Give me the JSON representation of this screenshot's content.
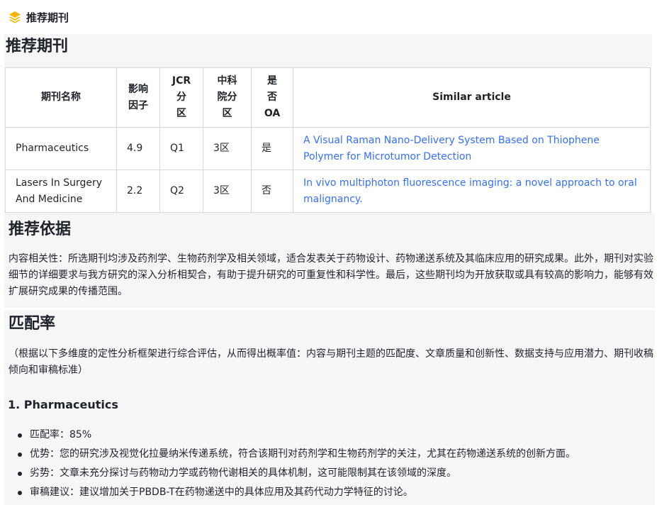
{
  "header": {
    "title": "推荐期刊",
    "icon": "layers-icon"
  },
  "recommend": {
    "title": "推荐期刊",
    "columns": [
      "期刊名称",
      "影响\n因子",
      "JCR\n分\n区",
      "中科\n院分\n区",
      "是\n否\nOA",
      "Similar article"
    ],
    "rows": [
      {
        "name": "Pharmaceutics",
        "if": "4.9",
        "jcr": "Q1",
        "cas": "3区",
        "oa": "是",
        "article": "A Visual Raman Nano-Delivery System Based on Thiophene Polymer for Microtumor Detection"
      },
      {
        "name": "Lasers In Surgery And Medicine",
        "if": "2.2",
        "jcr": "Q2",
        "cas": "3区",
        "oa": "否",
        "article": "In vivo multiphoton fluorescence imaging: a novel approach to oral malignancy."
      }
    ]
  },
  "basis": {
    "title": "推荐依据",
    "text": "内容相关性：所选期刊均涉及药剂学、生物药剂学及相关领域，适合发表关于药物设计、药物递送系统及其临床应用的研究成果。此外，期刊对实验细节的详细要求与我方研究的深入分析相契合，有助于提升研究的可重复性和科学性。最后，这些期刊均为开放获取或具有较高的影响力，能够有效扩展研究成果的传播范围。"
  },
  "match": {
    "title": "匹配率",
    "intro": "（根据以下多维度的定性分析框架进行综合评估，从而得出概率值：内容与期刊主题的匹配度、文章质量和创新性、数据支持与应用潜力、期刊收稿倾向和审稿标准）",
    "journal_heading": "1. Pharmaceutics",
    "items": [
      "匹配率：85%",
      "优势：您的研究涉及视觉化拉曼纳米传递系统，符合该期刊对药剂学和生物药剂学的关注，尤其在药物递送系统的创新方面。",
      "劣势：文章未充分探讨与药物动力学或药物代谢相关的具体机制，这可能限制其在该领域的深度。",
      "审稿建议：建议增加关于PBDB-T在药物递送中的具体应用及其药代动力学特征的讨论。"
    ]
  }
}
